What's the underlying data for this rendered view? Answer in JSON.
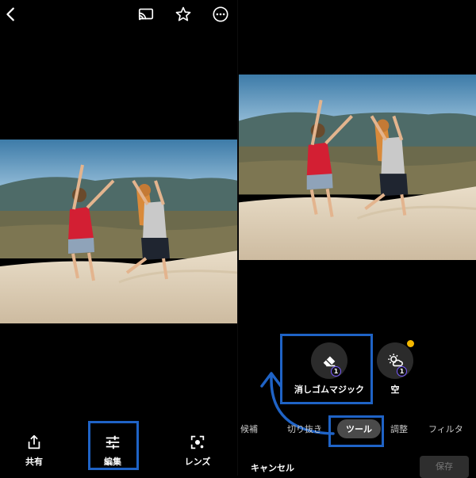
{
  "left_panel": {
    "toolbar": {
      "back_icon": "chevron-left-icon",
      "cast_icon": "cast-icon",
      "favorite_icon": "star-icon",
      "more_icon": "more-circle-icon"
    },
    "bottom_actions": [
      {
        "label": "共有",
        "icon": "share-icon"
      },
      {
        "label": "編集",
        "icon": "sliders-icon"
      },
      {
        "label": "レンズ",
        "icon": "lens-icon"
      }
    ]
  },
  "right_panel": {
    "tools": [
      {
        "label": "消しゴムマジック",
        "icon": "eraser-icon",
        "badge": "1"
      },
      {
        "label": "空",
        "icon": "sun-cloud-icon",
        "badge": "1"
      }
    ],
    "tabs": [
      {
        "label": "候補"
      },
      {
        "label": "切り抜き"
      },
      {
        "label": "ツール"
      },
      {
        "label": "調整"
      },
      {
        "label": "フィルタ"
      }
    ],
    "active_tab": "ツール",
    "cancel_label": "キャンセル",
    "save_label": "保存"
  },
  "colors": {
    "highlight": "#1f63c6",
    "background": "#000000",
    "badge_dot": "#f5b800"
  }
}
